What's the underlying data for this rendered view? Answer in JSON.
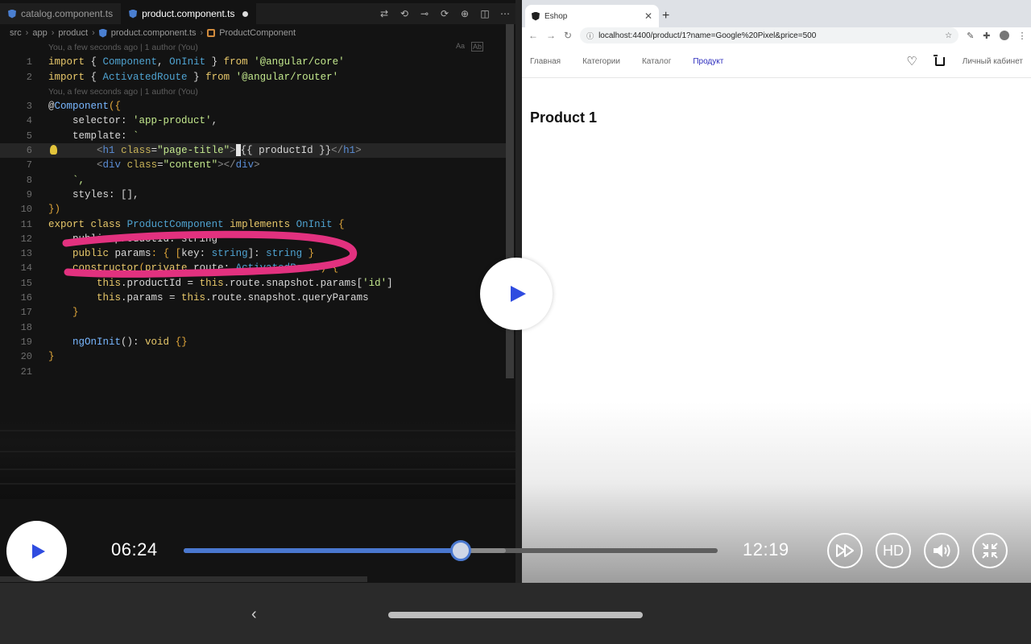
{
  "editor": {
    "tabs": [
      {
        "label": "catalog.component.ts",
        "active": false
      },
      {
        "label": "product.component.ts",
        "active": true,
        "modified": true
      }
    ],
    "breadcrumb": [
      "src",
      "app",
      "product",
      "product.component.ts",
      "ProductComponent"
    ],
    "blame_top": "You, a few seconds ago | 1 author (You)",
    "blame_mid": "You, a few seconds ago | 1 author (You)",
    "find_toggles": [
      "Aa",
      "Ab"
    ],
    "line_numbers": [
      "1",
      "2",
      "3",
      "4",
      "5",
      "6",
      "7",
      "8",
      "9",
      "10",
      "11",
      "12",
      "13",
      "14",
      "15",
      "16",
      "17",
      "18",
      "19",
      "20",
      "21"
    ],
    "code": {
      "l1": [
        "import",
        " { ",
        "Component",
        ", ",
        "OnInit",
        " } ",
        "from",
        " ",
        "'@angular/core'"
      ],
      "l2": [
        "import",
        " { ",
        "ActivatedRoute",
        " } ",
        "from",
        " ",
        "'@angular/router'"
      ],
      "l3": [
        "@",
        "Component",
        "({"
      ],
      "l4": [
        "selector",
        ": ",
        "'app-product'",
        ","
      ],
      "l5": [
        "template",
        ": ",
        "`"
      ],
      "l6": [
        "<",
        "h1",
        " ",
        "class",
        "=",
        "\"page-title\"",
        ">",
        "{{ productId }}",
        "</",
        "h1",
        ">"
      ],
      "l7": [
        "<",
        "div",
        " ",
        "class",
        "=",
        "\"content\"",
        "></",
        "div",
        ">"
      ],
      "l8": [
        "`,"
      ],
      "l9": [
        "styles",
        ": [],"
      ],
      "l10": [
        "})"
      ],
      "l11": [
        "export",
        " ",
        "class",
        " ",
        "ProductComponent",
        " ",
        "implements",
        " ",
        "OnInit",
        " {"
      ],
      "l12": [
        "public productId: string"
      ],
      "l13": [
        "public",
        " ",
        "params",
        ": { [",
        "key",
        ": ",
        "string",
        "]: ",
        "string",
        " }"
      ],
      "l14": [
        "constructor",
        "(",
        "private",
        " route: ",
        "ActivatedRoute",
        ") {"
      ],
      "l15": [
        "this",
        ".productId = ",
        "this",
        ".route.snapshot.params[",
        "'id'",
        "]"
      ],
      "l16": [
        "this",
        ".params = ",
        "this",
        ".route.snapshot.queryParams"
      ],
      "l17": [
        "}"
      ],
      "l19": [
        "ngOnInit",
        "(): ",
        "void",
        " {}"
      ],
      "l20": [
        "}"
      ]
    }
  },
  "browser": {
    "tab_title": "Eshop",
    "url": "localhost:4400/product/1?name=Google%20Pixel&price=500",
    "nav": [
      "Главная",
      "Категории",
      "Каталог",
      "Продукт"
    ],
    "active_nav": "Продукт",
    "account_link": "Личный кабинет",
    "page_title": "Product 1"
  },
  "player": {
    "current_time": "06:24",
    "duration": "12:19",
    "progress": 0.519,
    "buffered": 0.604,
    "hd_label": "HD",
    "accent_color": "#4a78d0",
    "play_color": "#2f4ce0"
  },
  "icons": {
    "next": "skip-forward-icon",
    "volume": "volume-icon",
    "exit_fullscreen": "exit-fullscreen-icon",
    "back": "back-chevron-icon"
  }
}
